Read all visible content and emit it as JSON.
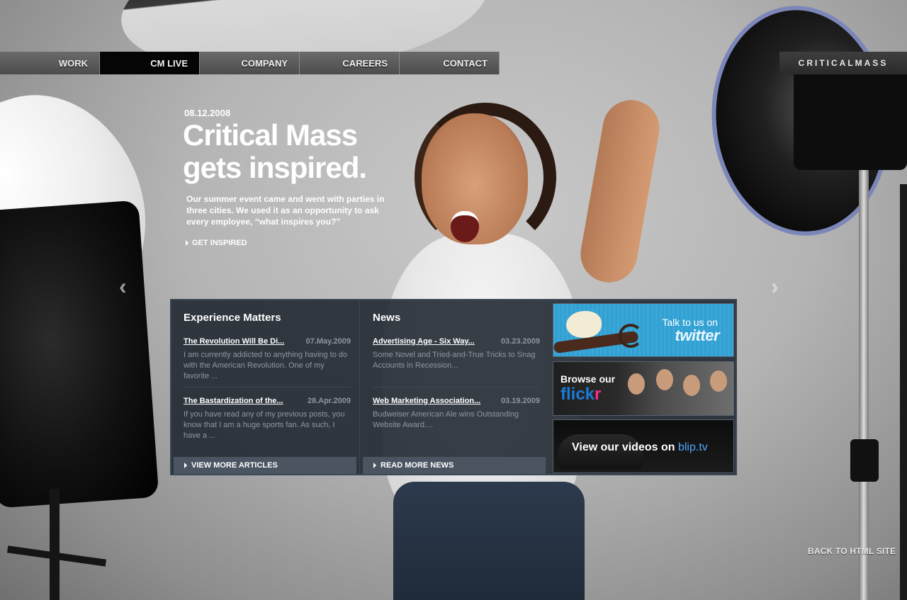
{
  "nav": {
    "items": [
      {
        "label": "WORK"
      },
      {
        "label": "CM LIVE",
        "active": true
      },
      {
        "label": "COMPANY"
      },
      {
        "label": "CAREERS"
      },
      {
        "label": "CONTACT"
      }
    ],
    "brand": "CRITICALMASS"
  },
  "hero": {
    "date": "08.12.2008",
    "title_line1": "Critical Mass",
    "title_line2": "gets inspired.",
    "body": "Our summer event came and went with parties in three cities. We used it as an opportunity to ask every employee, “what inspires you?”",
    "link": "GET INSPIRED"
  },
  "carousel": {
    "prev_icon": "chevron-left-icon",
    "next_icon": "chevron-right-icon",
    "prev_glyph": "‹",
    "next_glyph": "›"
  },
  "articles": {
    "title": "Experience Matters",
    "items": [
      {
        "title": "The Revolution Will Be Di...",
        "date": "07.May.2009",
        "text": "I am currently addicted to anything having to do with the American Revolution. One of my favorite ..."
      },
      {
        "title": "The Bastardization of the...",
        "date": "28.Apr.2009",
        "text": "If you have read any of my previous posts, you know that I am a huge sports fan. As such, I have a ..."
      }
    ],
    "more": "VIEW MORE ARTICLES"
  },
  "news": {
    "title": "News",
    "items": [
      {
        "title": "Advertising Age - Six Way...",
        "date": "03.23.2009",
        "text": "Some Novel and Tried-and-True Tricks to Snag Accounts in Recession..."
      },
      {
        "title": "Web Marketing Association...",
        "date": "03.19.2009",
        "text": "Budweiser American Ale wins Outstanding Website Award...."
      }
    ],
    "more": "READ MORE NEWS"
  },
  "promos": {
    "twitter": {
      "line1": "Talk to us on",
      "line2": "twitter",
      "color": "#3aa7d8"
    },
    "flickr": {
      "line1": "Browse our",
      "brand_a": "flick",
      "brand_b": "r",
      "blue": "#1b7bd6",
      "pink": "#ff2a8c"
    },
    "blip": {
      "text": "View our videos on ",
      "brand": "blip.tv",
      "color": "#4fa8ff"
    }
  },
  "footer": {
    "back_link": "BACK TO HTML SITE"
  }
}
